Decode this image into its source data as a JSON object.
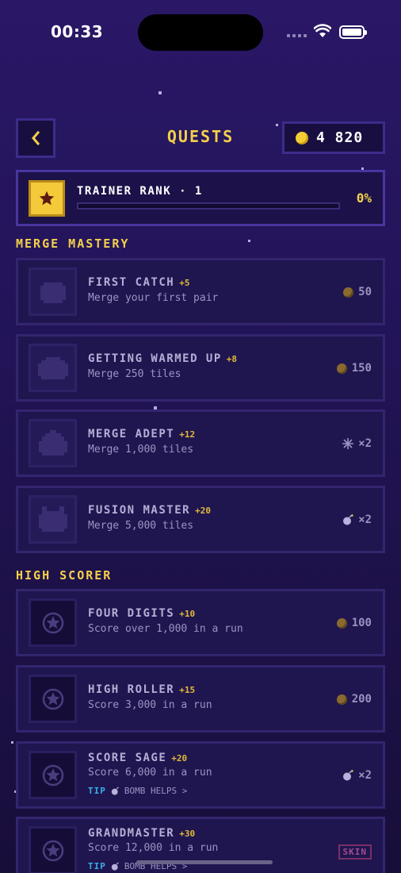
{
  "status_bar": {
    "time": "00:33"
  },
  "header": {
    "title": "QUESTS",
    "coins": "4 820"
  },
  "rank": {
    "title": "TRAINER RANK · 1",
    "percent": "0%",
    "progress": 0
  },
  "sections": [
    {
      "title": "MERGE MASTERY",
      "quests": [
        {
          "title": "FIRST CATCH",
          "xp": "+5",
          "desc": "Merge your first pair",
          "reward": "50",
          "reward_icon": "coin-icon"
        },
        {
          "title": "GETTING WARMED UP",
          "xp": "+8",
          "desc": "Merge 250 tiles",
          "reward": "150",
          "reward_icon": "coin-icon"
        },
        {
          "title": "MERGE ADEPT",
          "xp": "+12",
          "desc": "Merge 1,000 tiles",
          "reward": "×2",
          "reward_icon": "snowflake-icon"
        },
        {
          "title": "FUSION MASTER",
          "xp": "+20",
          "desc": "Merge 5,000 tiles",
          "reward": "×2",
          "reward_icon": "bomb-icon"
        }
      ]
    },
    {
      "title": "HIGH SCORER",
      "quests": [
        {
          "title": "FOUR DIGITS",
          "xp": "+10",
          "desc": "Score over 1,000 in a run",
          "reward": "100",
          "reward_icon": "coin-icon"
        },
        {
          "title": "HIGH ROLLER",
          "xp": "+15",
          "desc": "Score 3,000 in a run",
          "reward": "200",
          "reward_icon": "coin-icon"
        },
        {
          "title": "SCORE SAGE",
          "xp": "+20",
          "desc": "Score 6,000 in a run",
          "reward": "×2",
          "reward_icon": "bomb-icon",
          "tip_label": "TIP",
          "tip_text": "BOMB HELPS >"
        },
        {
          "title": "GRANDMASTER",
          "xp": "+30",
          "desc": "Score 12,000 in a run",
          "reward": "SKIN",
          "reward_icon": "skin-badge",
          "tip_label": "TIP",
          "tip_text": "BOMB HELPS >"
        }
      ]
    }
  ],
  "colors": {
    "accent_gold": "#f4d04a",
    "tip_blue": "#3bb0e8",
    "card_bg": "#1f1650"
  }
}
